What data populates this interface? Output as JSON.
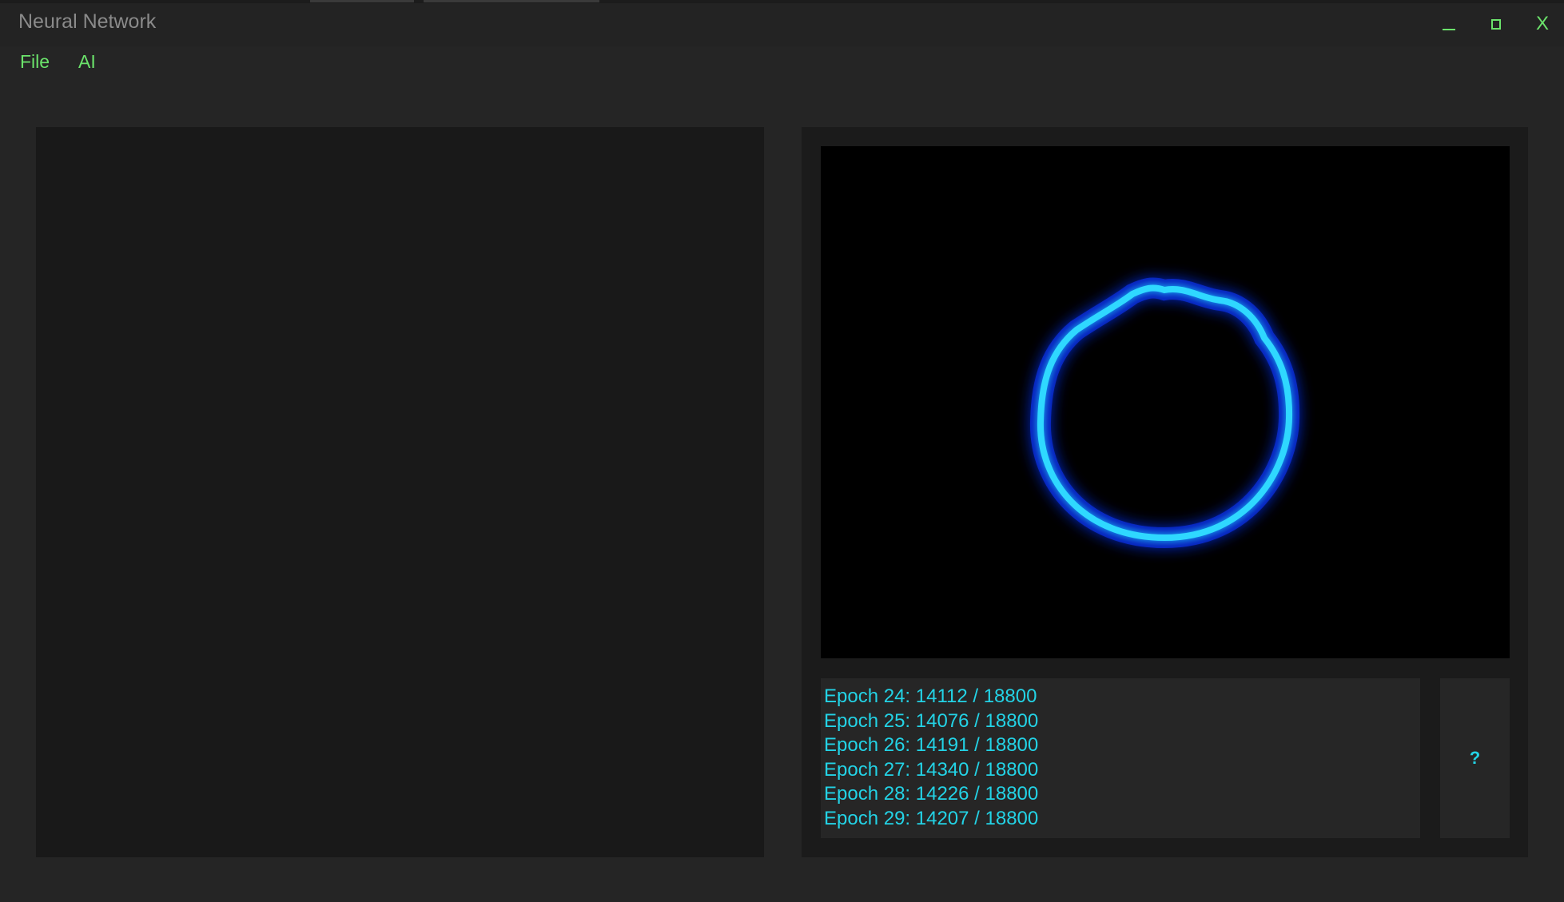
{
  "window": {
    "title": "Neural Network",
    "controls": {
      "minimize_icon": "minimize-icon",
      "maximize_icon": "maximize-icon",
      "close_label": "X"
    }
  },
  "menu": {
    "items": [
      {
        "label": "File"
      },
      {
        "label": "AI"
      }
    ]
  },
  "visualization": {
    "description_icon": "glowing-ring",
    "ring_color": "#1ec8ff",
    "glow_color": "#1030ff"
  },
  "log": {
    "lines": [
      "Epoch 24: 14112 / 18800",
      "Epoch 25: 14076 / 18800",
      "Epoch 26: 14191 / 18800",
      "Epoch 27: 14340 / 18800",
      "Epoch 28: 14226 / 18800",
      "Epoch 29: 14207 / 18800"
    ]
  },
  "help_button": {
    "label": "?"
  },
  "colors": {
    "accent_green": "#6be36b",
    "log_cyan": "#23d3e6",
    "background": "#252525"
  }
}
